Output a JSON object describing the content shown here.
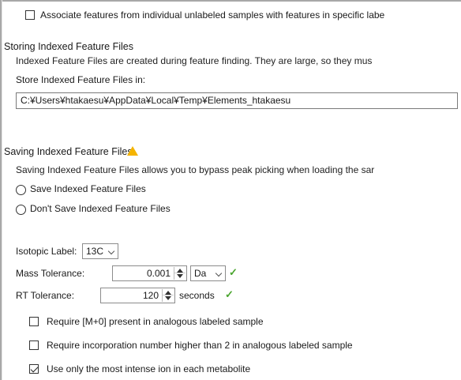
{
  "top_option": {
    "label": "Associate features from individual unlabeled samples with features in specific labe",
    "checked": false
  },
  "storing": {
    "header": "Storing Indexed Feature Files",
    "description": "Indexed Feature Files are created during feature finding.  They are large, so they mus",
    "store_label": "Store Indexed Feature Files in:",
    "path_value": "C:¥Users¥htakaesu¥AppData¥Local¥Temp¥Elements_htakaesu"
  },
  "saving": {
    "header": "Saving Indexed Feature Files",
    "warning_icon": "warning-icon",
    "description": "Saving Indexed Feature Files allows you to bypass peak picking when loading the sar",
    "options": [
      {
        "label": "Save Indexed Feature Files",
        "selected": false
      },
      {
        "label": "Don't Save Indexed Feature Files",
        "selected": false
      }
    ]
  },
  "isotopic": {
    "label": "Isotopic Label:",
    "value": "13C"
  },
  "mass_tolerance": {
    "label": "Mass Tolerance:",
    "value": "0.001",
    "unit": "Da",
    "valid": true
  },
  "rt_tolerance": {
    "label": "RT Tolerance:",
    "value": "120",
    "unit": "seconds",
    "valid": true
  },
  "checkboxes": [
    {
      "label": "Require [M+0] present in analogous labeled sample",
      "checked": false
    },
    {
      "label": "Require incorporation number higher than 2 in analogous labeled sample",
      "checked": false
    },
    {
      "label": "Use only the most intense ion in each metabolite",
      "checked": true
    }
  ],
  "colors": {
    "warning": "#f5b400",
    "valid_check": "#4aa52e"
  }
}
